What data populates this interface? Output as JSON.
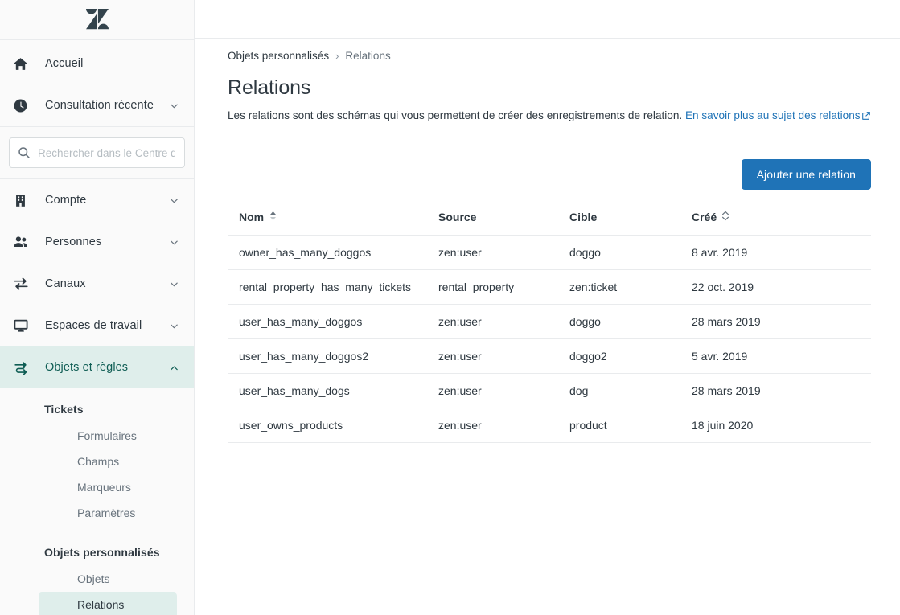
{
  "brand": {
    "logo_icon": "zendesk-logo",
    "accent_blue": "#1f73b7",
    "active_green_bg": "#dfeeeb",
    "active_green_fg": "#0f5d54"
  },
  "sidebar": {
    "search": {
      "icon": "search-icon",
      "placeholder": "Rechercher dans le Centre d",
      "value": ""
    },
    "primary_items": [
      {
        "label": "Accueil",
        "icon": "home-icon",
        "chevron": false,
        "active": false
      },
      {
        "label": "Consultation récente",
        "icon": "clock-icon",
        "chevron": true,
        "active": false
      }
    ],
    "items": [
      {
        "label": "Compte",
        "icon": "building-icon",
        "chevron": true,
        "active": false
      },
      {
        "label": "Personnes",
        "icon": "people-icon",
        "chevron": true,
        "active": false
      },
      {
        "label": "Canaux",
        "icon": "arrows-icon",
        "chevron": true,
        "active": false
      },
      {
        "label": "Espaces de travail",
        "icon": "monitor-icon",
        "chevron": true,
        "active": false
      },
      {
        "label": "Objets et règles",
        "icon": "objects-rules-icon",
        "chevron": true,
        "active": true
      }
    ],
    "sections": [
      {
        "title": "Tickets",
        "items": [
          {
            "label": "Formulaires",
            "selected": false
          },
          {
            "label": "Champs",
            "selected": false
          },
          {
            "label": "Marqueurs",
            "selected": false
          },
          {
            "label": "Paramètres",
            "selected": false
          }
        ]
      },
      {
        "title": "Objets personnalisés",
        "items": [
          {
            "label": "Objets",
            "selected": false
          },
          {
            "label": "Relations",
            "selected": true
          }
        ]
      }
    ]
  },
  "main": {
    "breadcrumb": {
      "root": "Objets personnalisés",
      "separator": "›",
      "current": "Relations"
    },
    "title": "Relations",
    "description": "Les relations sont des schémas qui vous permettent de créer des enregistrements de relation.",
    "description_link": "En savoir plus au sujet des relations",
    "external_link_icon": "external-link-icon",
    "add_button": "Ajouter une relation",
    "table": {
      "columns": [
        {
          "label": "Nom",
          "sort_icon": "sort-active-icon",
          "sortable": true
        },
        {
          "label": "Source",
          "sort_icon": "",
          "sortable": false
        },
        {
          "label": "Cible",
          "sort_icon": "",
          "sortable": false
        },
        {
          "label": "Créé",
          "sort_icon": "sort-inactive-icon",
          "sortable": true
        }
      ],
      "rows": [
        {
          "nom": "owner_has_many_doggos",
          "source": "zen:user",
          "cible": "doggo",
          "cree": "8 avr. 2019"
        },
        {
          "nom": "rental_property_has_many_tickets",
          "source": "rental_property",
          "cible": "zen:ticket",
          "cree": "22 oct. 2019"
        },
        {
          "nom": "user_has_many_doggos",
          "source": "zen:user",
          "cible": "doggo",
          "cree": "28 mars 2019"
        },
        {
          "nom": "user_has_many_doggos2",
          "source": "zen:user",
          "cible": "doggo2",
          "cree": "5 avr. 2019"
        },
        {
          "nom": "user_has_many_dogs",
          "source": "zen:user",
          "cible": "dog",
          "cree": "28 mars 2019"
        },
        {
          "nom": "user_owns_products",
          "source": "zen:user",
          "cible": "product",
          "cree": "18 juin 2020"
        }
      ]
    }
  }
}
